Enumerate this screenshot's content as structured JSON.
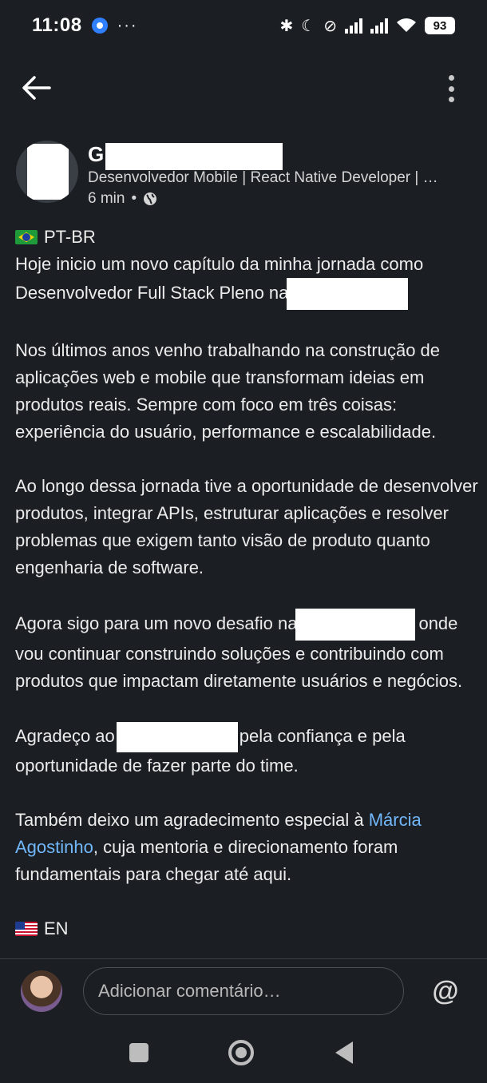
{
  "status_bar": {
    "time": "11:08",
    "dots": "···",
    "battery": "93",
    "bluetooth_icon": "✱",
    "moon_icon": "☾",
    "vibrate_icon": "⊘"
  },
  "author": {
    "name_initial": "G",
    "headline": "Desenvolvedor Mobile | React Native Developer | …",
    "time_ago": "6 min",
    "separator": "•"
  },
  "post": {
    "lang_pt": "PT-BR",
    "p1_line1": "Hoje inicio um novo capítulo da minha jornada como",
    "p1_line2": "Desenvolvedor Full Stack Pleno na",
    "p2": "Nos últimos anos venho trabalhando na construção de aplicações web e mobile que transformam ideias em produtos reais. Sempre com foco em três coisas: experiência do usuário, performance e escalabilidade.",
    "p3": "Ao longo dessa jornada tive a oportunidade de desenvolver produtos, integrar APIs, estruturar aplicações e resolver problemas que exigem tanto visão de produto quanto engenharia de software.",
    "p4_before": "Agora sigo para um novo desafio na",
    "p4_after": "onde vou continuar construindo soluções e contribuindo com produtos que impactam diretamente usuários e negócios.",
    "p5_before": "Agradeço ao",
    "p5_after": "pela confiança e pela oportunidade de fazer parte do time.",
    "p6_before": "Também deixo um agradecimento especial à",
    "p6_mention": "Márcia Agostinho",
    "p6_after": ", cuja mentoria e direcionamento foram fundamentais para chegar até aqui.",
    "lang_en": "EN"
  },
  "comment": {
    "placeholder": "Adicionar comentário…",
    "at_label": "@"
  }
}
